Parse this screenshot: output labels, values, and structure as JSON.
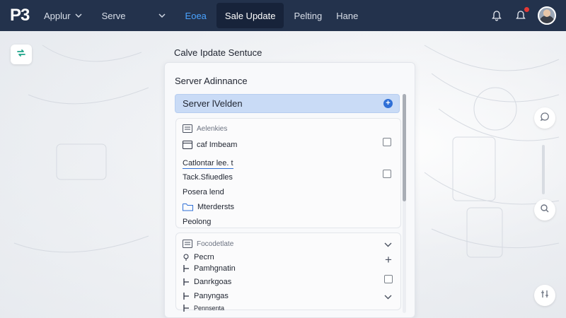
{
  "topbar": {
    "logo": "P3",
    "nav": [
      {
        "label": "Applur",
        "chevron": true
      },
      {
        "label": "Serve",
        "chevron": true
      },
      {
        "label": "Eoea",
        "style": "link"
      },
      {
        "label": "Sale Update",
        "style": "active"
      },
      {
        "label": "Pelting"
      },
      {
        "label": "Hane"
      }
    ],
    "icons": [
      "bell-icon",
      "notification-icon",
      "avatar"
    ],
    "badge_color": "#e53935"
  },
  "left_button_icon": "sync-icon",
  "rail_icons": [
    "chat-icon",
    "search-icon",
    "grid-icon"
  ],
  "main": {
    "heading": "Calve Ipdate Sentuce",
    "panel_title": "Server Adinnance",
    "selected_item": "Server lVelden",
    "group1": {
      "header": "Aelenkies",
      "rows": [
        "caf Imbeam",
        "Catlontar lee. t",
        "Tack.Sfiuedles",
        "Posera lend",
        "Mterdersts",
        "Peolong"
      ]
    },
    "group2": {
      "header": "Focodetlate",
      "rows": [
        "Pecrn",
        "Pamhgnatin",
        "Danrkgoas",
        "Panyngas",
        "Pennsenta"
      ]
    }
  },
  "colors": {
    "topbar": "#23324c",
    "accent": "#2f6fd6",
    "link": "#4aa3ff",
    "selected_bg": "#c9dbf6"
  }
}
